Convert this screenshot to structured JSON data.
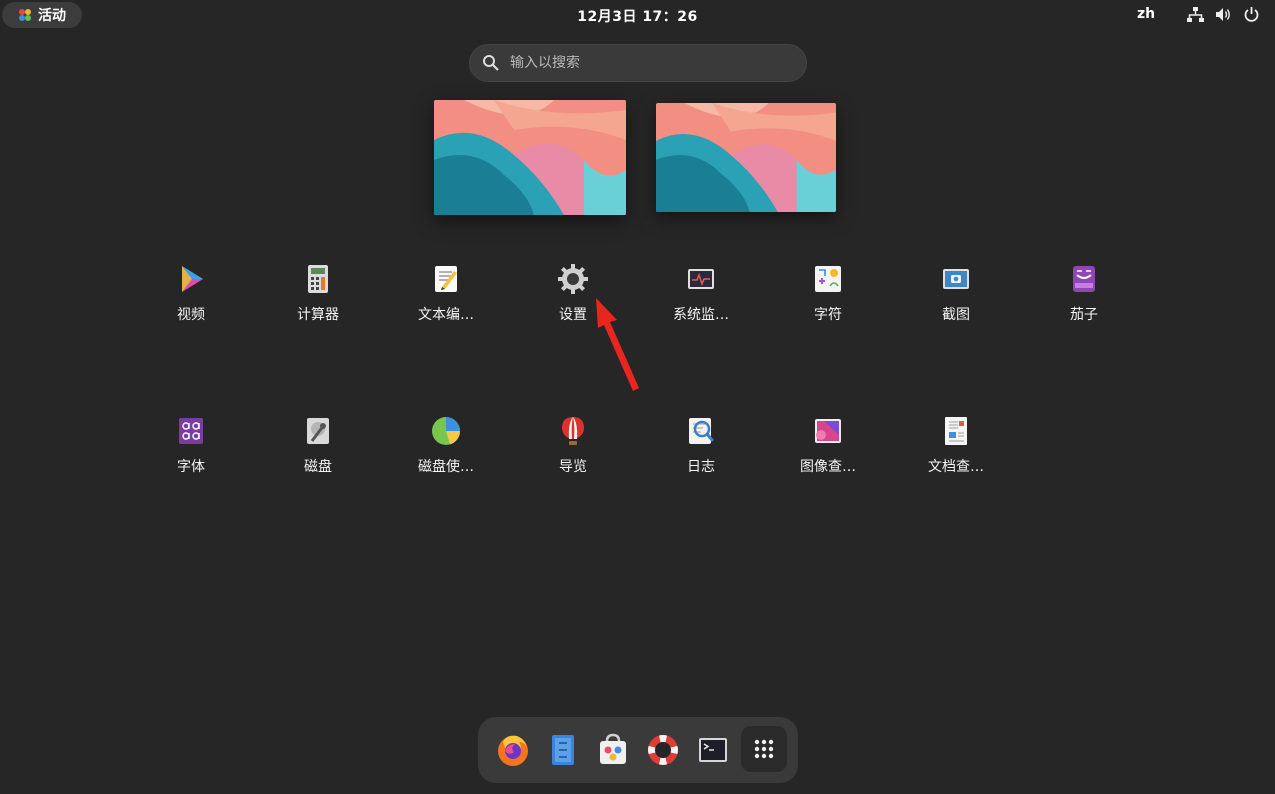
{
  "topbar": {
    "activities_label": "活动",
    "clock": "12月3日  17：26",
    "language": "zh",
    "icons": [
      "network-icon",
      "volume-icon",
      "power-icon"
    ]
  },
  "search": {
    "placeholder": "输入以搜索"
  },
  "workspaces": [
    "workspace-1",
    "workspace-2"
  ],
  "apps_row1": [
    {
      "label": "视频",
      "icon": "video-icon"
    },
    {
      "label": "计算器",
      "icon": "calculator-icon"
    },
    {
      "label": "文本编…",
      "icon": "text-editor-icon"
    },
    {
      "label": "设置",
      "icon": "settings-gear-icon"
    },
    {
      "label": "系统监…",
      "icon": "system-monitor-icon"
    },
    {
      "label": "字符",
      "icon": "characters-icon"
    },
    {
      "label": "截图",
      "icon": "screenshot-icon"
    },
    {
      "label": "茄子",
      "icon": "cheese-icon"
    }
  ],
  "apps_row2": [
    {
      "label": "字体",
      "icon": "fonts-icon"
    },
    {
      "label": "磁盘",
      "icon": "disks-icon"
    },
    {
      "label": "磁盘使…",
      "icon": "disk-usage-icon"
    },
    {
      "label": "导览",
      "icon": "tour-icon"
    },
    {
      "label": "日志",
      "icon": "logs-icon"
    },
    {
      "label": "图像查…",
      "icon": "image-viewer-icon"
    },
    {
      "label": "文档查…",
      "icon": "document-viewer-icon"
    }
  ],
  "dock": [
    "firefox-icon",
    "files-icon",
    "software-icon",
    "help-icon",
    "terminal-icon",
    "show-apps-icon"
  ],
  "colors": {
    "background": "#262626",
    "panel": "#3a3a3a",
    "annotation_arrow": "#e8251e"
  }
}
